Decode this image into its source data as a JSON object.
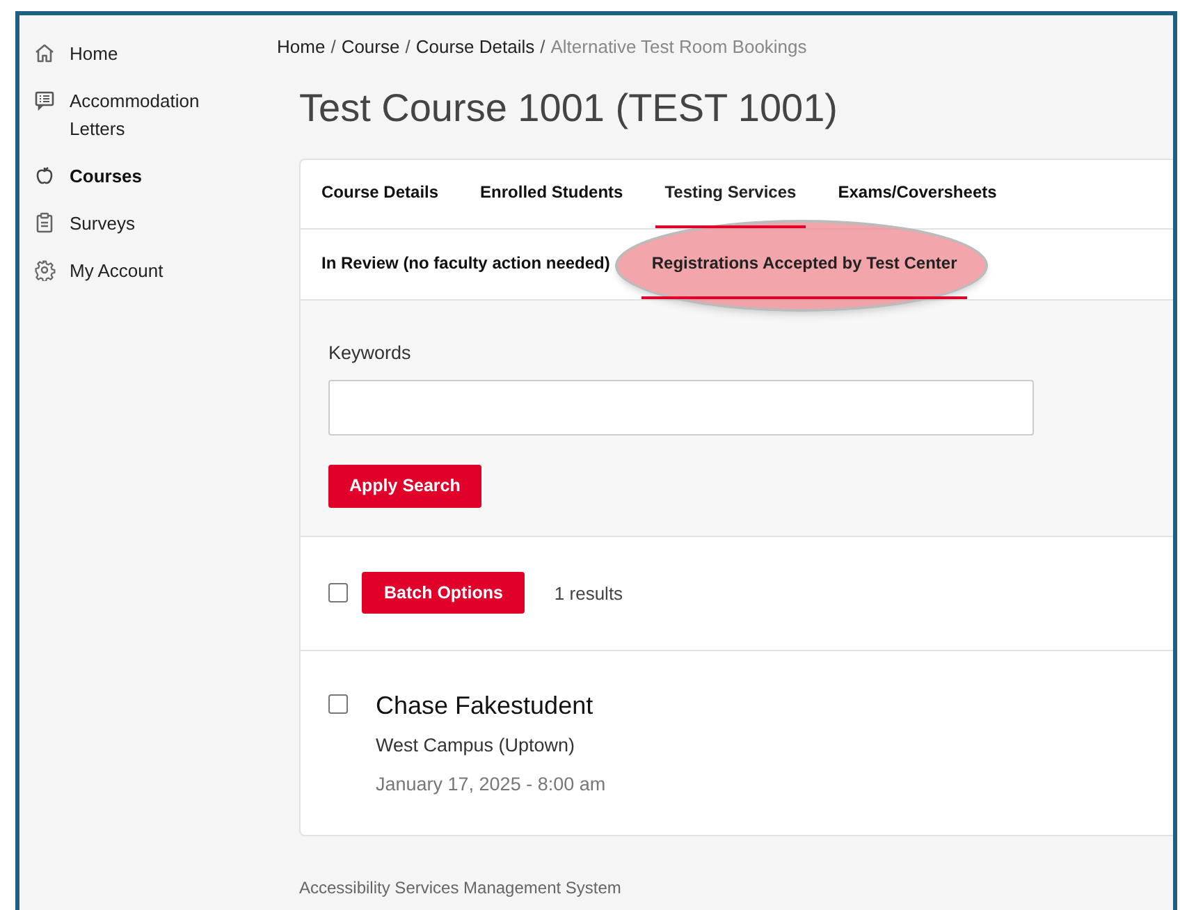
{
  "sidebar": {
    "items": [
      {
        "label": "Home",
        "selected": false
      },
      {
        "label": "Accommodation Letters",
        "selected": false
      },
      {
        "label": "Courses",
        "selected": true
      },
      {
        "label": "Surveys",
        "selected": false
      },
      {
        "label": "My Account",
        "selected": false
      }
    ]
  },
  "breadcrumb": {
    "separator": "/",
    "items": [
      {
        "label": "Home",
        "current": false
      },
      {
        "label": "Course",
        "current": false
      },
      {
        "label": "Course Details",
        "current": false
      },
      {
        "label": "Alternative Test Room Bookings",
        "current": true
      }
    ]
  },
  "page_title": "Test Course 1001 (TEST 1001)",
  "tabs": [
    {
      "label": "Course Details",
      "selected": false
    },
    {
      "label": "Enrolled Students",
      "selected": false
    },
    {
      "label": "Testing Services",
      "selected": true
    },
    {
      "label": "Exams/Coversheets",
      "selected": false
    }
  ],
  "subtabs": [
    {
      "label": "In Review (no faculty action needed)",
      "selected": false,
      "highlighted": false
    },
    {
      "label": "Registrations Accepted by Test Center",
      "selected": true,
      "highlighted": true
    }
  ],
  "search": {
    "label": "Keywords",
    "button": "Apply Search"
  },
  "results_bar": {
    "checked": false,
    "button": "Batch Options",
    "count": "1 results"
  },
  "results": [
    {
      "name": "Chase Fakestudent",
      "location": "West Campus (Uptown)",
      "datetime": "January 17, 2025 - 8:00 am",
      "checked": false
    }
  ],
  "footer": "Accessibility Services Management System"
}
